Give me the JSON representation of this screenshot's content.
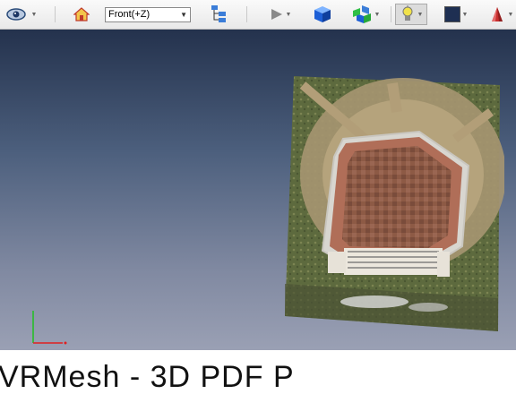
{
  "toolbar": {
    "view_select": {
      "value": "Front(+Z)"
    },
    "icons": [
      "viewer-mode-icon",
      "home-icon",
      "view-dropdown",
      "tree-icon",
      "play-icon",
      "cube-blue-icon",
      "cubes-multi-icon",
      "light-icon",
      "color-swatch-icon",
      "material-icon"
    ]
  },
  "colors": {
    "bg_top": "#24324d",
    "bg_bottom": "#9aa0b4",
    "axis_x": "#e02020",
    "axis_y": "#20c020"
  },
  "caption": {
    "text": "VRMesh - 3D PDF P"
  }
}
